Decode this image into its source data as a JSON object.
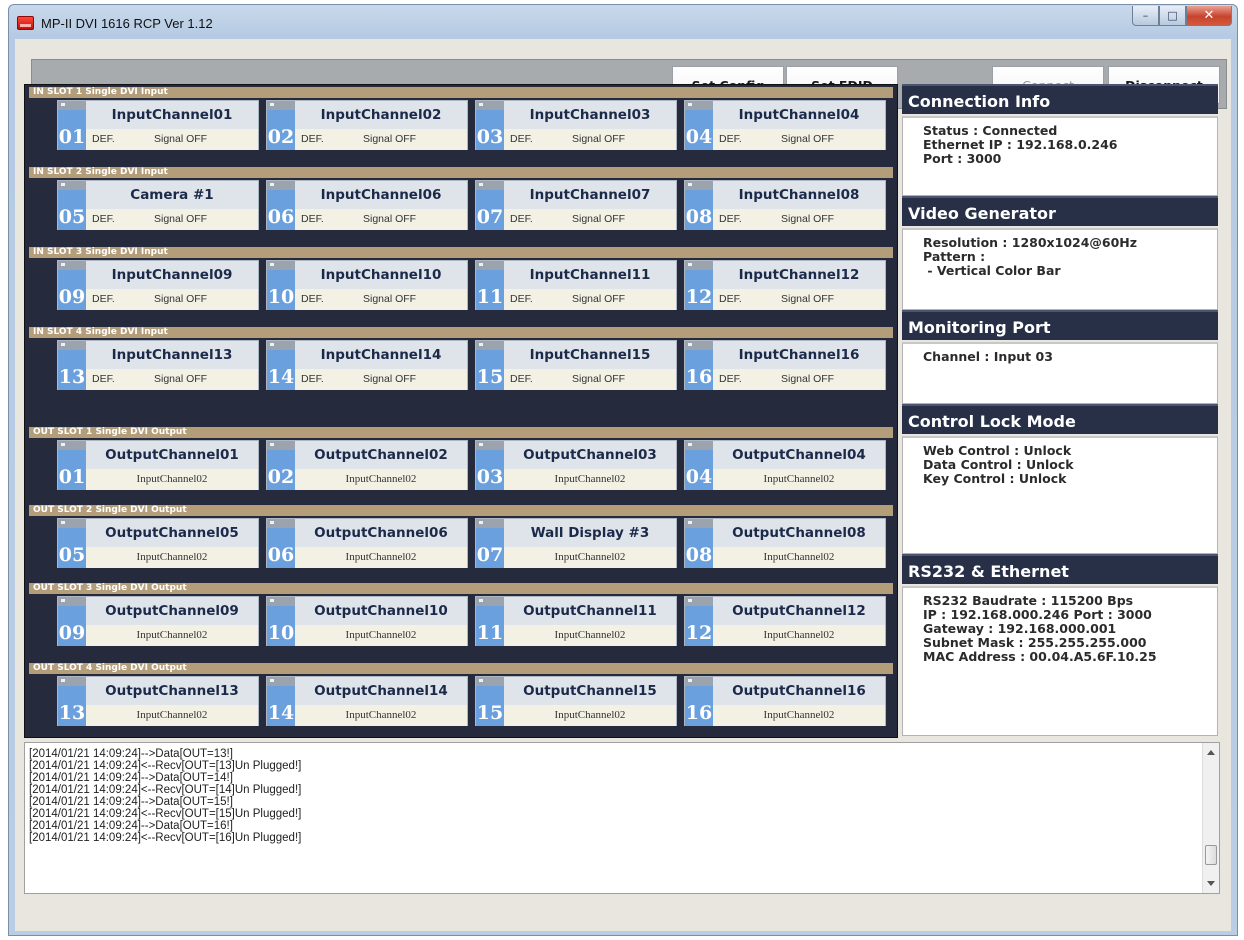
{
  "window": {
    "title": "MP-II DVI 1616   RCP Ver 1.12"
  },
  "toolbar": {
    "set_config": "Set Config",
    "set_edid": "Set EDID",
    "connect": "Connect",
    "disconnect": "Disconnect"
  },
  "input_slots": [
    {
      "label": "IN SLOT 1   Single DVI Input",
      "channels": [
        {
          "num": "01",
          "name": "InputChannel01",
          "def": "DEF.",
          "signal": "Signal OFF"
        },
        {
          "num": "02",
          "name": "InputChannel02",
          "def": "DEF.",
          "signal": "Signal OFF"
        },
        {
          "num": "03",
          "name": "InputChannel03",
          "def": "DEF.",
          "signal": "Signal OFF"
        },
        {
          "num": "04",
          "name": "InputChannel04",
          "def": "DEF.",
          "signal": "Signal OFF"
        }
      ]
    },
    {
      "label": "IN SLOT 2   Single DVI Input",
      "channels": [
        {
          "num": "05",
          "name": "Camera #1",
          "def": "DEF.",
          "signal": "Signal OFF"
        },
        {
          "num": "06",
          "name": "InputChannel06",
          "def": "DEF.",
          "signal": "Signal OFF"
        },
        {
          "num": "07",
          "name": "InputChannel07",
          "def": "DEF.",
          "signal": "Signal OFF"
        },
        {
          "num": "08",
          "name": "InputChannel08",
          "def": "DEF.",
          "signal": "Signal OFF"
        }
      ]
    },
    {
      "label": "IN SLOT 3   Single DVI Input",
      "channels": [
        {
          "num": "09",
          "name": "InputChannel09",
          "def": "DEF.",
          "signal": "Signal OFF"
        },
        {
          "num": "10",
          "name": "InputChannel10",
          "def": "DEF.",
          "signal": "Signal OFF"
        },
        {
          "num": "11",
          "name": "InputChannel11",
          "def": "DEF.",
          "signal": "Signal OFF"
        },
        {
          "num": "12",
          "name": "InputChannel12",
          "def": "DEF.",
          "signal": "Signal OFF"
        }
      ]
    },
    {
      "label": "IN SLOT 4   Single DVI Input",
      "channels": [
        {
          "num": "13",
          "name": "InputChannel13",
          "def": "DEF.",
          "signal": "Signal OFF"
        },
        {
          "num": "14",
          "name": "InputChannel14",
          "def": "DEF.",
          "signal": "Signal OFF"
        },
        {
          "num": "15",
          "name": "InputChannel15",
          "def": "DEF.",
          "signal": "Signal OFF"
        },
        {
          "num": "16",
          "name": "InputChannel16",
          "def": "DEF.",
          "signal": "Signal OFF"
        }
      ]
    }
  ],
  "output_slots": [
    {
      "label": "OUT SLOT 1   Single DVI Output",
      "channels": [
        {
          "num": "01",
          "name": "OutputChannel01",
          "route": "InputChannel02"
        },
        {
          "num": "02",
          "name": "OutputChannel02",
          "route": "InputChannel02"
        },
        {
          "num": "03",
          "name": "OutputChannel03",
          "route": "InputChannel02"
        },
        {
          "num": "04",
          "name": "OutputChannel04",
          "route": "InputChannel02"
        }
      ]
    },
    {
      "label": "OUT SLOT 2   Single DVI Output",
      "channels": [
        {
          "num": "05",
          "name": "OutputChannel05",
          "route": "InputChannel02"
        },
        {
          "num": "06",
          "name": "OutputChannel06",
          "route": "InputChannel02"
        },
        {
          "num": "07",
          "name": "Wall Display #3",
          "route": "InputChannel02"
        },
        {
          "num": "08",
          "name": "OutputChannel08",
          "route": "InputChannel02"
        }
      ]
    },
    {
      "label": "OUT SLOT 3   Single DVI Output",
      "channels": [
        {
          "num": "09",
          "name": "OutputChannel09",
          "route": "InputChannel02"
        },
        {
          "num": "10",
          "name": "OutputChannel10",
          "route": "InputChannel02"
        },
        {
          "num": "11",
          "name": "OutputChannel11",
          "route": "InputChannel02"
        },
        {
          "num": "12",
          "name": "OutputChannel12",
          "route": "InputChannel02"
        }
      ]
    },
    {
      "label": "OUT SLOT 4   Single DVI Output",
      "channels": [
        {
          "num": "13",
          "name": "OutputChannel13",
          "route": "InputChannel02"
        },
        {
          "num": "14",
          "name": "OutputChannel14",
          "route": "InputChannel02"
        },
        {
          "num": "15",
          "name": "OutputChannel15",
          "route": "InputChannel02"
        },
        {
          "num": "16",
          "name": "OutputChannel16",
          "route": "InputChannel02"
        }
      ]
    }
  ],
  "info": [
    {
      "title": "Connection Info",
      "lines": [
        "Status : Connected",
        "Ethernet IP : 192.168.0.246",
        "Port : 3000"
      ]
    },
    {
      "title": "Video Generator",
      "lines": [
        "Resolution : 1280x1024@60Hz",
        "Pattern :",
        " - Vertical Color Bar"
      ]
    },
    {
      "title": "Monitoring Port",
      "lines": [
        "Channel : Input 03"
      ]
    },
    {
      "title": "Control Lock Mode",
      "lines": [
        "Web Control : Unlock",
        "Data Control : Unlock",
        "Key Control : Unlock"
      ]
    },
    {
      "title": "RS232 & Ethernet",
      "lines": [
        "RS232  Baudrate : 115200 Bps",
        "IP : 192.168.000.246   Port : 3000",
        "Gateway : 192.168.000.001",
        "Subnet Mask : 255.255.255.000",
        "MAC Address : 00.04.A5.6F.10.25"
      ]
    }
  ],
  "log": [
    "[2014/01/21 14:09:24]-->Data[OUT=13!]",
    "[2014/01/21 14:09:24]<--Recv[OUT=[13]Un Plugged!]",
    "[2014/01/21 14:09:24]-->Data[OUT=14!]",
    "[2014/01/21 14:09:24]<--Recv[OUT=[14]Un Plugged!]",
    "[2014/01/21 14:09:24]-->Data[OUT=15!]",
    "[2014/01/21 14:09:24]<--Recv[OUT=[15]Un Plugged!]",
    "[2014/01/21 14:09:24]-->Data[OUT=16!]",
    "[2014/01/21 14:09:24]<--Recv[OUT=[16]Un Plugged!]"
  ]
}
